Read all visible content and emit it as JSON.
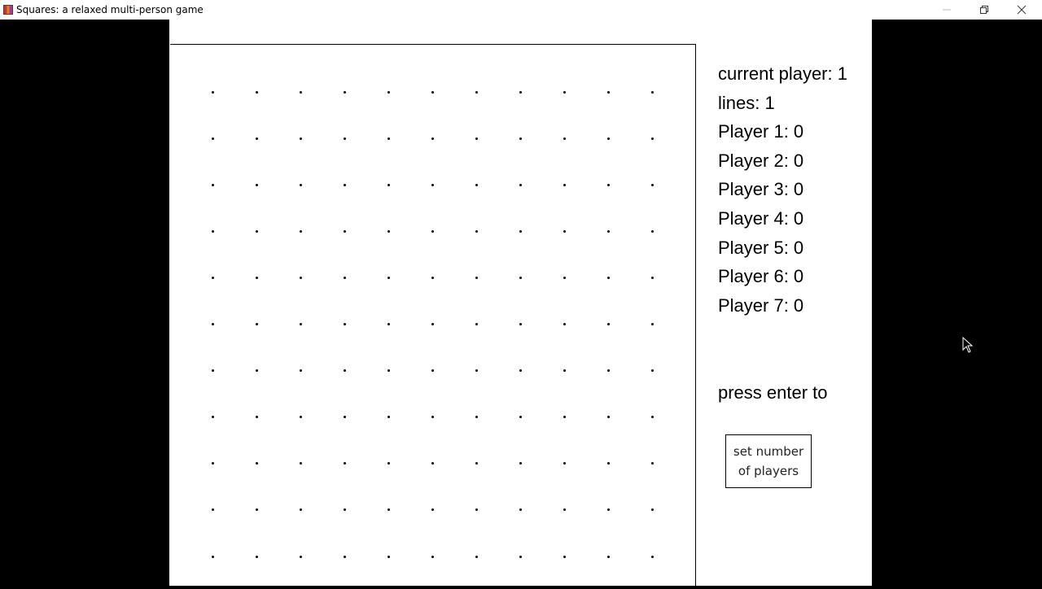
{
  "window": {
    "title": "Squares: a relaxed multi-person game",
    "icon": "app-icon"
  },
  "board": {
    "rows": 11,
    "cols": 11
  },
  "status": {
    "current_player": "current player: 1",
    "lines": "lines:  1"
  },
  "scores": [
    "Player 1: 0",
    "Player 2: 0",
    "Player 3: 0",
    "Player 4: 0",
    "Player 5: 0",
    "Player 6: 0",
    "Player 7: 0"
  ],
  "prompt": "press enter to",
  "set_players_button": {
    "line1": "set number",
    "line2": "of players"
  }
}
